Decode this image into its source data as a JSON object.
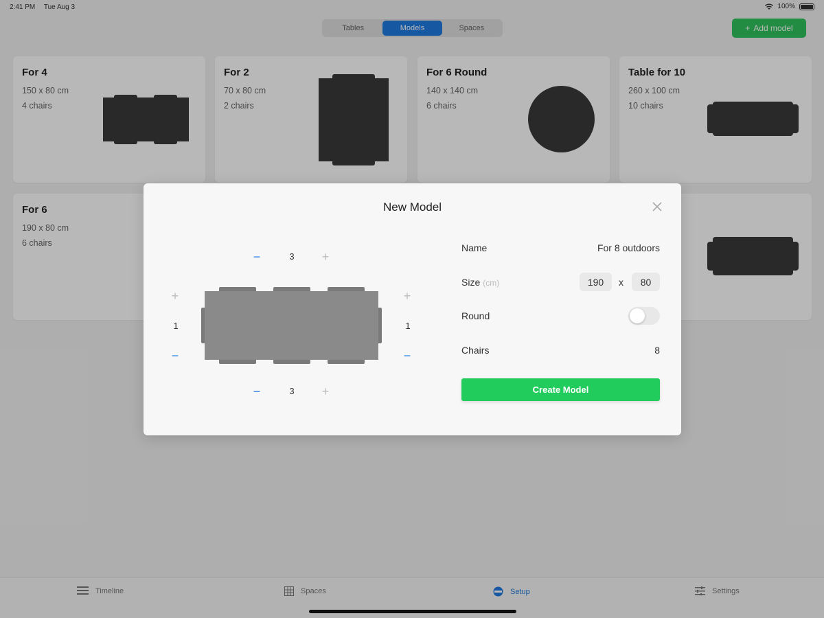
{
  "status": {
    "time": "2:41 PM",
    "date": "Tue Aug 3",
    "battery": "100%"
  },
  "segments": [
    {
      "label": "Tables"
    },
    {
      "label": "Models"
    },
    {
      "label": "Spaces"
    }
  ],
  "header": {
    "add_label": "Add model"
  },
  "cards": [
    {
      "title": "For 4",
      "size": "150 x 80 cm",
      "chairs": "4 chairs"
    },
    {
      "title": "For 2",
      "size": "70 x 80 cm",
      "chairs": "2 chairs"
    },
    {
      "title": "For 6 Round",
      "size": "140 x 140 cm",
      "chairs": "6 chairs"
    },
    {
      "title": "Table for 10",
      "size": "260 x 100 cm",
      "chairs": "10 chairs"
    },
    {
      "title": "For 6",
      "size": "190 x 80 cm",
      "chairs": "6 chairs"
    }
  ],
  "modal": {
    "title": "New Model",
    "top_count": "3",
    "bottom_count": "3",
    "left_count": "1",
    "right_count": "1",
    "name_label": "Name",
    "name_value": "For 8 outdoors",
    "size_label": "Size",
    "size_unit": "(cm)",
    "width": "190",
    "x_sep": "x",
    "depth": "80",
    "round_label": "Round",
    "round_on": false,
    "chairs_label": "Chairs",
    "chairs_value": "8",
    "create_label": "Create Model"
  },
  "tabs": [
    {
      "label": "Timeline",
      "icon": "list-icon"
    },
    {
      "label": "Spaces",
      "icon": "grid-icon"
    },
    {
      "label": "Setup",
      "icon": "setup-icon"
    },
    {
      "label": "Settings",
      "icon": "sliders-icon"
    }
  ],
  "colors": {
    "accent": "#1f7ae0",
    "green": "#2fc35c",
    "table": "#3a3a3a"
  }
}
